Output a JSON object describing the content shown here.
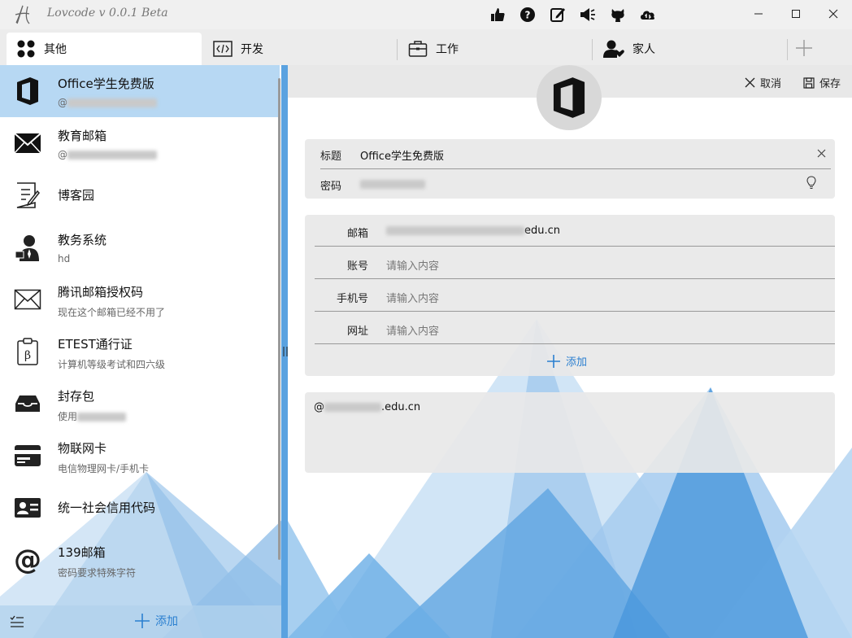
{
  "app": {
    "title": "Lovcode  v 0.0.1 Beta"
  },
  "tabs": [
    {
      "label": "其他",
      "icon": "apps-icon"
    },
    {
      "label": "开发",
      "icon": "code-icon"
    },
    {
      "label": "工作",
      "icon": "briefcase-icon"
    },
    {
      "label": "家人",
      "icon": "family-icon"
    }
  ],
  "list": [
    {
      "title": "Office学生免费版",
      "sub_prefix": "@",
      "sub": "",
      "icon": "office-icon"
    },
    {
      "title": "教育邮箱",
      "sub_prefix": "@",
      "sub": "",
      "icon": "mail-icon"
    },
    {
      "title": "博客园",
      "sub_prefix": "",
      "sub": "",
      "icon": "note-icon"
    },
    {
      "title": "教务系统",
      "sub_prefix": "",
      "sub": "hd",
      "icon": "user-tie-icon"
    },
    {
      "title": "腾讯邮箱授权码",
      "sub_prefix": "",
      "sub": "现在这个邮箱已经不用了",
      "icon": "envelope-icon"
    },
    {
      "title": "ETEST通行证",
      "sub_prefix": "",
      "sub": "计算机等级考试和四六级",
      "icon": "clipboard-beta-icon"
    },
    {
      "title": "封存包",
      "sub_prefix": "使用",
      "sub": "",
      "icon": "inbox-icon"
    },
    {
      "title": "物联网卡",
      "sub_prefix": "",
      "sub": "电信物理网卡/手机卡",
      "icon": "credit-card-icon"
    },
    {
      "title": "统一社会信用代码",
      "sub_prefix": "",
      "sub": "",
      "icon": "id-card-icon"
    },
    {
      "title": "139邮箱",
      "sub_prefix": "",
      "sub": "密码要求特殊字符",
      "icon": "at-icon"
    }
  ],
  "left_footer": {
    "add_label": "添加"
  },
  "toolbar": {
    "cancel_label": "取消",
    "save_label": "保存"
  },
  "detail": {
    "title_label": "标题",
    "title_value": "Office学生免费版",
    "password_label": "密码",
    "fields": [
      {
        "label": "邮箱",
        "value": "edu.cn",
        "placeholder": ""
      },
      {
        "label": "账号",
        "value": "",
        "placeholder": "请输入内容"
      },
      {
        "label": "手机号",
        "value": "",
        "placeholder": "请输入内容"
      },
      {
        "label": "网址",
        "value": "",
        "placeholder": "请输入内容"
      }
    ],
    "add_label": "添加",
    "note_prefix": "@",
    "note_suffix": ".edu.cn"
  },
  "colors": {
    "accent": "#2a7fd0",
    "selected": "#b7d8f3",
    "splitter": "#5aa2e0"
  }
}
